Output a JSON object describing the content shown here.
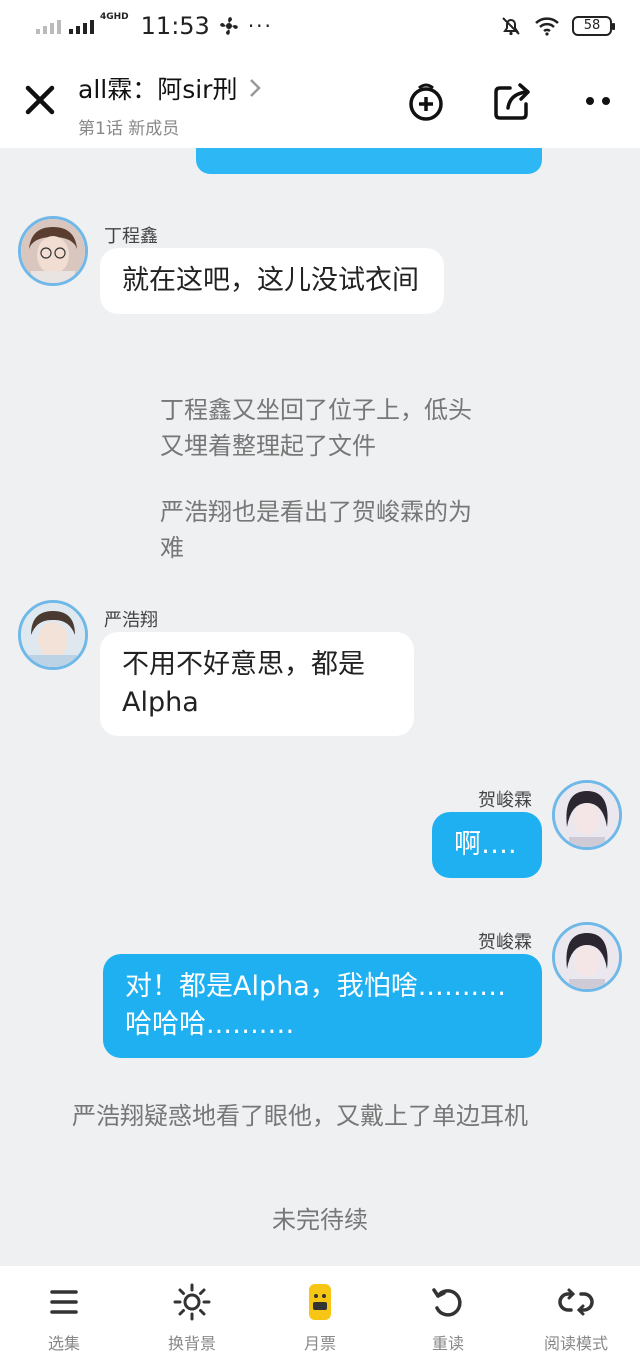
{
  "status_bar": {
    "network": "4GHD",
    "time": "11:53",
    "more": "···",
    "battery": "58"
  },
  "header": {
    "title": "all霖：阿sir刑",
    "subtitle": "第1话 新成员"
  },
  "messages": [
    {
      "type": "left",
      "speaker": "丁程鑫",
      "text": "就在这吧，这儿没试衣间"
    },
    {
      "type": "narration",
      "text": "丁程鑫又坐回了位子上，低头又埋着整理起了文件"
    },
    {
      "type": "narration",
      "text": "严浩翔也是看出了贺峻霖的为难"
    },
    {
      "type": "left",
      "speaker": "严浩翔",
      "text": "不用不好意思，都是Alpha"
    },
    {
      "type": "right",
      "speaker": "贺峻霖",
      "text": "啊…."
    },
    {
      "type": "right",
      "speaker": "贺峻霖",
      "text": "对！都是Alpha，我怕啥..…..…哈哈哈..…..…"
    },
    {
      "type": "narration",
      "text": "严浩翔疑惑地看了眼他，又戴上了单边耳机"
    }
  ],
  "end_text": "未完待续",
  "bottom_tabs": [
    {
      "label": "选集",
      "icon": "menu-icon"
    },
    {
      "label": "换背景",
      "icon": "sun-icon"
    },
    {
      "label": "月票",
      "icon": "ticket-icon"
    },
    {
      "label": "重读",
      "icon": "replay-icon"
    },
    {
      "label": "阅读模式",
      "icon": "loop-icon"
    }
  ],
  "colors": {
    "accent_blue": "#1eb0f0",
    "background": "#eef0f2",
    "avatar_ring": "#6fb8e8",
    "ticket_yellow": "#f7c514"
  }
}
